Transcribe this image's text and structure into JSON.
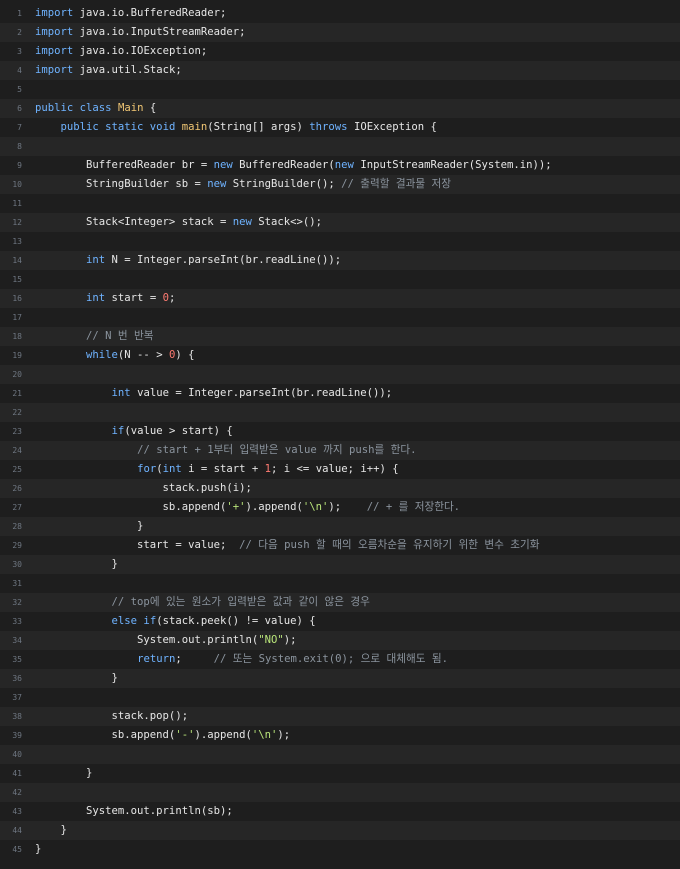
{
  "colors": {
    "background": "#1e1e1e",
    "alt_line": "#262626",
    "keyword": "#6fb3ff",
    "function": "#f0c674",
    "string": "#b9e57a",
    "number": "#ff7b72",
    "comment": "#8b949e",
    "line_number": "#6e7681"
  },
  "lines": [
    {
      "n": "1",
      "tokens": [
        [
          "kw",
          "import"
        ],
        [
          "pl",
          " java.io.BufferedReader;"
        ]
      ]
    },
    {
      "n": "2",
      "tokens": [
        [
          "kw",
          "import"
        ],
        [
          "pl",
          " java.io.InputStreamReader;"
        ]
      ]
    },
    {
      "n": "3",
      "tokens": [
        [
          "kw",
          "import"
        ],
        [
          "pl",
          " java.io.IOException;"
        ]
      ]
    },
    {
      "n": "4",
      "tokens": [
        [
          "kw",
          "import"
        ],
        [
          "pl",
          " java.util.Stack;"
        ]
      ]
    },
    {
      "n": "5",
      "tokens": []
    },
    {
      "n": "6",
      "tokens": [
        [
          "kw",
          "public class"
        ],
        [
          "pl",
          " "
        ],
        [
          "fn",
          "Main"
        ],
        [
          "pl",
          " {"
        ]
      ]
    },
    {
      "n": "7",
      "tokens": [
        [
          "pl",
          "    "
        ],
        [
          "kw",
          "public static void"
        ],
        [
          "pl",
          " "
        ],
        [
          "fn",
          "main"
        ],
        [
          "pl",
          "(String[] args) "
        ],
        [
          "kw",
          "throws"
        ],
        [
          "pl",
          " IOException {"
        ]
      ]
    },
    {
      "n": "8",
      "tokens": []
    },
    {
      "n": "9",
      "tokens": [
        [
          "pl",
          "        BufferedReader br = "
        ],
        [
          "kw",
          "new"
        ],
        [
          "pl",
          " BufferedReader("
        ],
        [
          "kw",
          "new"
        ],
        [
          "pl",
          " InputStreamReader(System.in));"
        ]
      ]
    },
    {
      "n": "10",
      "tokens": [
        [
          "pl",
          "        StringBuilder sb = "
        ],
        [
          "kw",
          "new"
        ],
        [
          "pl",
          " StringBuilder(); "
        ],
        [
          "cm",
          "// 출력할 결과물 저장"
        ]
      ]
    },
    {
      "n": "11",
      "tokens": []
    },
    {
      "n": "12",
      "tokens": [
        [
          "pl",
          "        Stack<Integer> stack = "
        ],
        [
          "kw",
          "new"
        ],
        [
          "pl",
          " Stack<>();"
        ]
      ]
    },
    {
      "n": "13",
      "tokens": []
    },
    {
      "n": "14",
      "tokens": [
        [
          "pl",
          "        "
        ],
        [
          "kw",
          "int"
        ],
        [
          "pl",
          " N = Integer.parseInt(br.readLine());"
        ]
      ]
    },
    {
      "n": "15",
      "tokens": []
    },
    {
      "n": "16",
      "tokens": [
        [
          "pl",
          "        "
        ],
        [
          "kw",
          "int"
        ],
        [
          "pl",
          " start = "
        ],
        [
          "num",
          "0"
        ],
        [
          "pl",
          ";"
        ]
      ]
    },
    {
      "n": "17",
      "tokens": []
    },
    {
      "n": "18",
      "tokens": [
        [
          "pl",
          "        "
        ],
        [
          "cm",
          "// N 번 반복"
        ]
      ]
    },
    {
      "n": "19",
      "tokens": [
        [
          "pl",
          "        "
        ],
        [
          "kw",
          "while"
        ],
        [
          "pl",
          "(N -- > "
        ],
        [
          "num",
          "0"
        ],
        [
          "pl",
          ") {"
        ]
      ]
    },
    {
      "n": "20",
      "tokens": []
    },
    {
      "n": "21",
      "tokens": [
        [
          "pl",
          "            "
        ],
        [
          "kw",
          "int"
        ],
        [
          "pl",
          " value = Integer.parseInt(br.readLine());"
        ]
      ]
    },
    {
      "n": "22",
      "tokens": []
    },
    {
      "n": "23",
      "tokens": [
        [
          "pl",
          "            "
        ],
        [
          "kw",
          "if"
        ],
        [
          "pl",
          "(value > start) {"
        ]
      ]
    },
    {
      "n": "24",
      "tokens": [
        [
          "pl",
          "                "
        ],
        [
          "cm",
          "// start + 1부터 입력받은 value 까지 push를 한다."
        ]
      ]
    },
    {
      "n": "25",
      "tokens": [
        [
          "pl",
          "                "
        ],
        [
          "kw",
          "for"
        ],
        [
          "pl",
          "("
        ],
        [
          "kw",
          "int"
        ],
        [
          "pl",
          " i = start + "
        ],
        [
          "num",
          "1"
        ],
        [
          "pl",
          "; i <= value; i++) {"
        ]
      ]
    },
    {
      "n": "26",
      "tokens": [
        [
          "pl",
          "                    stack.push(i);"
        ]
      ]
    },
    {
      "n": "27",
      "tokens": [
        [
          "pl",
          "                    sb.append("
        ],
        [
          "str",
          "'+'"
        ],
        [
          "pl",
          ").append("
        ],
        [
          "str",
          "'\\n'"
        ],
        [
          "pl",
          ");    "
        ],
        [
          "cm",
          "// + 를 저장한다."
        ]
      ]
    },
    {
      "n": "28",
      "tokens": [
        [
          "pl",
          "                }"
        ]
      ]
    },
    {
      "n": "29",
      "tokens": [
        [
          "pl",
          "                start = value;  "
        ],
        [
          "cm",
          "// 다음 push 할 때의 오름차순을 유지하기 위한 변수 초기화"
        ]
      ]
    },
    {
      "n": "30",
      "tokens": [
        [
          "pl",
          "            }"
        ]
      ]
    },
    {
      "n": "31",
      "tokens": []
    },
    {
      "n": "32",
      "tokens": [
        [
          "pl",
          "            "
        ],
        [
          "cm",
          "// top에 있는 원소가 입력받은 값과 같이 않은 경우"
        ]
      ]
    },
    {
      "n": "33",
      "tokens": [
        [
          "pl",
          "            "
        ],
        [
          "kw",
          "else if"
        ],
        [
          "pl",
          "(stack.peek() != value) {"
        ]
      ]
    },
    {
      "n": "34",
      "tokens": [
        [
          "pl",
          "                System.out.println("
        ],
        [
          "str",
          "\"NO\""
        ],
        [
          "pl",
          ");"
        ]
      ]
    },
    {
      "n": "35",
      "tokens": [
        [
          "pl",
          "                "
        ],
        [
          "kw",
          "return"
        ],
        [
          "pl",
          ";     "
        ],
        [
          "cm",
          "// 또는 System.exit(0); 으로 대체해도 됨."
        ]
      ]
    },
    {
      "n": "36",
      "tokens": [
        [
          "pl",
          "            }"
        ]
      ]
    },
    {
      "n": "37",
      "tokens": []
    },
    {
      "n": "38",
      "tokens": [
        [
          "pl",
          "            stack.pop();"
        ]
      ]
    },
    {
      "n": "39",
      "tokens": [
        [
          "pl",
          "            sb.append("
        ],
        [
          "str",
          "'-'"
        ],
        [
          "pl",
          ").append("
        ],
        [
          "str",
          "'\\n'"
        ],
        [
          "pl",
          ");"
        ]
      ]
    },
    {
      "n": "40",
      "tokens": []
    },
    {
      "n": "41",
      "tokens": [
        [
          "pl",
          "        }"
        ]
      ]
    },
    {
      "n": "42",
      "tokens": []
    },
    {
      "n": "43",
      "tokens": [
        [
          "pl",
          "        System.out.println(sb);"
        ]
      ]
    },
    {
      "n": "44",
      "tokens": [
        [
          "pl",
          "    }"
        ]
      ]
    },
    {
      "n": "45",
      "tokens": [
        [
          "pl",
          "}"
        ]
      ]
    }
  ]
}
